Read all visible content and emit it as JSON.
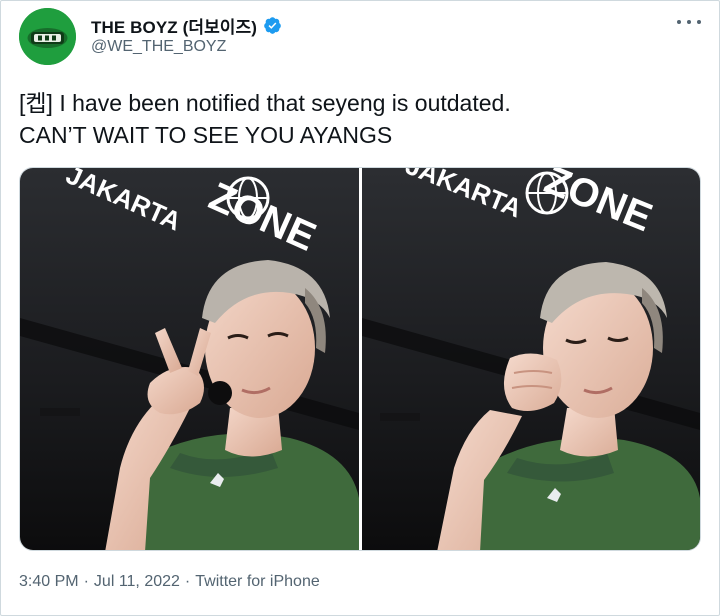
{
  "author": {
    "display_name": "THE BOYZ (더보이즈)",
    "handle": "@WE_THE_BOYZ",
    "verified_icon": "verified-badge-icon",
    "accent_color": "#1d9bf0"
  },
  "tweet": {
    "line1": "[켑] I have been notified that seyeng is outdated.",
    "line2": "CAN’T WAIT TO SEE YOU AYANGS"
  },
  "media": {
    "photos": [
      {
        "sign_line1": "JAKARTA",
        "sign_line2": "ZONE"
      },
      {
        "sign_line1": "JAKARTA",
        "sign_line2": "ZONE"
      }
    ]
  },
  "footer": {
    "time": "3:40 PM",
    "dot1": "·",
    "date": "Jul 11, 2022",
    "dot2": "·",
    "source": "Twitter for iPhone"
  }
}
